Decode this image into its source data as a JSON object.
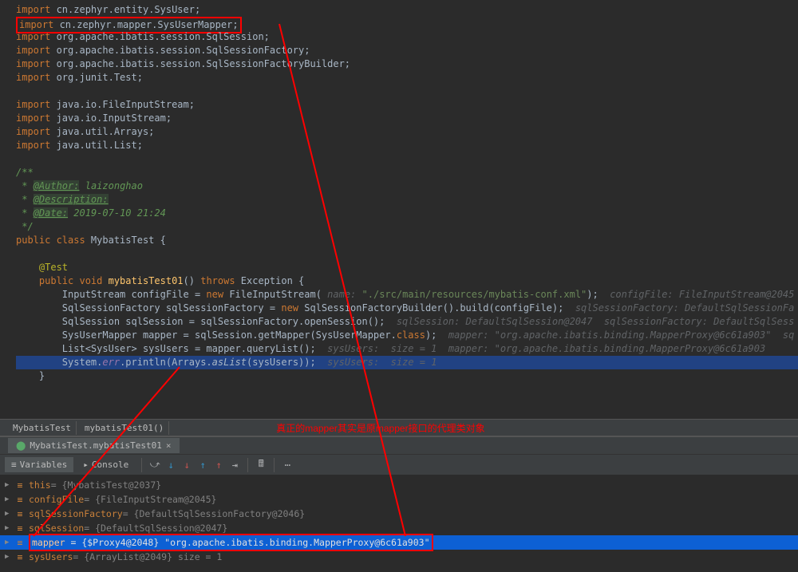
{
  "code_lines": [
    {
      "indent": 0,
      "segments": [
        {
          "t": "import ",
          "c": "kw"
        },
        {
          "t": "cn.zephyr.entity.SysUser;",
          "c": ""
        }
      ]
    },
    {
      "indent": 0,
      "boxed": true,
      "segments": [
        {
          "t": "import ",
          "c": "kw"
        },
        {
          "t": "cn.zephyr.mapper.SysUserMapper;",
          "c": ""
        }
      ]
    },
    {
      "indent": 0,
      "segments": [
        {
          "t": "import ",
          "c": "kw"
        },
        {
          "t": "org.apache.ibatis.session.SqlSession;",
          "c": ""
        }
      ]
    },
    {
      "indent": 0,
      "segments": [
        {
          "t": "import ",
          "c": "kw"
        },
        {
          "t": "org.apache.ibatis.session.SqlSessionFactory;",
          "c": ""
        }
      ]
    },
    {
      "indent": 0,
      "segments": [
        {
          "t": "import ",
          "c": "kw"
        },
        {
          "t": "org.apache.ibatis.session.SqlSessionFactoryBuilder;",
          "c": ""
        }
      ]
    },
    {
      "indent": 0,
      "segments": [
        {
          "t": "import ",
          "c": "kw"
        },
        {
          "t": "org.junit.Test;",
          "c": ""
        }
      ]
    },
    {
      "indent": 0,
      "segments": []
    },
    {
      "indent": 0,
      "segments": [
        {
          "t": "import ",
          "c": "kw"
        },
        {
          "t": "java.io.FileInputStream;",
          "c": ""
        }
      ]
    },
    {
      "indent": 0,
      "segments": [
        {
          "t": "import ",
          "c": "kw"
        },
        {
          "t": "java.io.InputStream;",
          "c": ""
        }
      ]
    },
    {
      "indent": 0,
      "segments": [
        {
          "t": "import ",
          "c": "kw"
        },
        {
          "t": "java.util.Arrays;",
          "c": ""
        }
      ]
    },
    {
      "indent": 0,
      "segments": [
        {
          "t": "import ",
          "c": "kw"
        },
        {
          "t": "java.util.List;",
          "c": ""
        }
      ]
    },
    {
      "indent": 0,
      "segments": []
    },
    {
      "indent": 0,
      "segments": [
        {
          "t": "/**",
          "c": "doc"
        }
      ]
    },
    {
      "indent": 0,
      "segments": [
        {
          "t": " * ",
          "c": "doc"
        },
        {
          "t": "@Author:",
          "c": "doctag"
        },
        {
          "t": " ",
          "c": "doc"
        },
        {
          "t": "laizonghao",
          "c": "doc"
        }
      ]
    },
    {
      "indent": 0,
      "segments": [
        {
          "t": " * ",
          "c": "doc"
        },
        {
          "t": "@Description:",
          "c": "doctag"
        }
      ]
    },
    {
      "indent": 0,
      "segments": [
        {
          "t": " * ",
          "c": "doc"
        },
        {
          "t": "@Date:",
          "c": "doctag"
        },
        {
          "t": " 2019-07-10 21:24",
          "c": "doc"
        }
      ]
    },
    {
      "indent": 0,
      "segments": [
        {
          "t": " */",
          "c": "doc"
        }
      ]
    },
    {
      "indent": 0,
      "segments": [
        {
          "t": "public class ",
          "c": "kw"
        },
        {
          "t": "MybatisTest {",
          "c": ""
        }
      ]
    },
    {
      "indent": 0,
      "segments": []
    },
    {
      "indent": 1,
      "segments": [
        {
          "t": "@Test",
          "c": "anno"
        }
      ]
    },
    {
      "indent": 1,
      "segments": [
        {
          "t": "public void ",
          "c": "kw"
        },
        {
          "t": "mybatisTest01",
          "c": "method"
        },
        {
          "t": "() ",
          "c": ""
        },
        {
          "t": "throws ",
          "c": "kw"
        },
        {
          "t": "Exception {",
          "c": ""
        }
      ]
    },
    {
      "indent": 2,
      "segments": [
        {
          "t": "InputStream configFile = ",
          "c": ""
        },
        {
          "t": "new ",
          "c": "kw"
        },
        {
          "t": "FileInputStream( ",
          "c": ""
        },
        {
          "t": "name: ",
          "c": "hint"
        },
        {
          "t": "\"./src/main/resources/mybatis-conf.xml\"",
          "c": "str"
        },
        {
          "t": ");  ",
          "c": ""
        },
        {
          "t": "configFile: FileInputStream@2045",
          "c": "hint"
        }
      ]
    },
    {
      "indent": 2,
      "segments": [
        {
          "t": "SqlSessionFactory sqlSessionFactory = ",
          "c": ""
        },
        {
          "t": "new ",
          "c": "kw"
        },
        {
          "t": "SqlSessionFactoryBuilder().build(configFile);  ",
          "c": ""
        },
        {
          "t": "sqlSessionFactory: DefaultSqlSessionFa",
          "c": "hint"
        }
      ]
    },
    {
      "indent": 2,
      "segments": [
        {
          "t": "SqlSession sqlSession = sqlSessionFactory.openSession();  ",
          "c": ""
        },
        {
          "t": "sqlSession: DefaultSqlSession@2047  sqlSessionFactory: DefaultSqlSess",
          "c": "hint"
        }
      ]
    },
    {
      "indent": 2,
      "segments": [
        {
          "t": "SysUserMapper mapper = sqlSession.getMapper(SysUserMapper.",
          "c": ""
        },
        {
          "t": "class",
          "c": "kw"
        },
        {
          "t": ");  ",
          "c": ""
        },
        {
          "t": "mapper: \"org.apache.ibatis.binding.MapperProxy@6c61a903\"  sq",
          "c": "hint"
        }
      ]
    },
    {
      "indent": 2,
      "segments": [
        {
          "t": "List<SysUser> sysUsers = mapper.queryList();  ",
          "c": ""
        },
        {
          "t": "sysUsers:  size = 1  mapper: \"org.apache.ibatis.binding.MapperProxy@6c61a903",
          "c": "hint"
        }
      ]
    },
    {
      "indent": 2,
      "highlighted": true,
      "segments": [
        {
          "t": "System.",
          "c": ""
        },
        {
          "t": "err",
          "c": "err-ref"
        },
        {
          "t": ".println(Arrays.",
          "c": ""
        },
        {
          "t": "asList",
          "c": "static-call"
        },
        {
          "t": "(sysUsers));  ",
          "c": ""
        },
        {
          "t": "sysUsers:  size = 1",
          "c": "hint"
        }
      ]
    },
    {
      "indent": 1,
      "segments": [
        {
          "t": "}",
          "c": ""
        }
      ]
    },
    {
      "indent": 0,
      "segments": []
    }
  ],
  "breadcrumb": {
    "items": [
      "MybatisTest",
      "mybatisTest01()"
    ],
    "annotation": "真正的mapper其实是原mapper接口的代理类对象"
  },
  "debug_tab": {
    "label": "MybatisTest.mybatisTest01"
  },
  "debug_toolbar": {
    "tabs": [
      {
        "label": "Variables",
        "icon": "≡",
        "active": true
      },
      {
        "label": "Console",
        "icon": "▸",
        "active": false
      }
    ]
  },
  "variables": [
    {
      "name": "this",
      "value": " = {MybatisTest@2037}",
      "icon": "orange",
      "selected": false
    },
    {
      "name": "configFile",
      "value": " = {FileInputStream@2045}",
      "icon": "orange",
      "selected": false
    },
    {
      "name": "sqlSessionFactory",
      "value": " = {DefaultSqlSessionFactory@2046}",
      "icon": "orange",
      "selected": false
    },
    {
      "name": "sqlSession",
      "value": " = {DefaultSqlSession@2047}",
      "icon": "orange",
      "selected": false
    },
    {
      "name": "mapper",
      "value": " = {$Proxy4@2048} \"org.apache.ibatis.binding.MapperProxy@6c61a903\"",
      "icon": "orange",
      "selected": true,
      "boxed": true
    },
    {
      "name": "sysUsers",
      "value": " = {ArrayList@2049}  size = 1",
      "icon": "orange",
      "selected": false
    }
  ]
}
